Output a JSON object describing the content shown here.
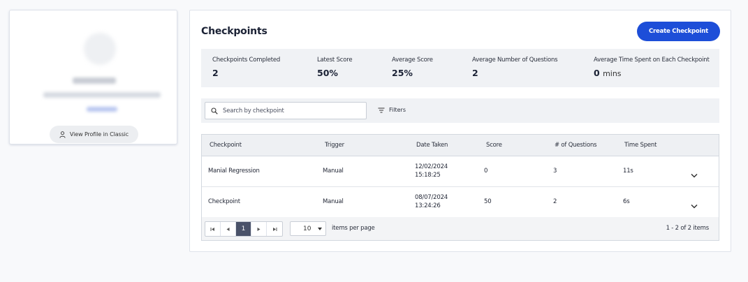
{
  "profile": {
    "view_profile_label": "View Profile in Classic"
  },
  "panel": {
    "title": "Checkpoints",
    "create_label": "Create Checkpoint"
  },
  "stats": [
    {
      "label": "Checkpoints Completed",
      "value": "2"
    },
    {
      "label": "Latest Score",
      "value": "50%"
    },
    {
      "label": "Average Score",
      "value": "25%"
    },
    {
      "label": "Average Number of Questions",
      "value": "2"
    },
    {
      "label": "Average Time Spent on Each Checkpoint",
      "value": "0",
      "unit": "mins"
    }
  ],
  "search": {
    "placeholder": "Search by checkpoint",
    "value": ""
  },
  "filters_label": "Filters",
  "table": {
    "columns": [
      "Checkpoint",
      "Trigger",
      "Date Taken",
      "Score",
      "# of Questions",
      "Time Spent"
    ],
    "rows": [
      {
        "checkpoint": "Manial Regression",
        "trigger": "Manual",
        "date": "12/02/2024",
        "time": "15:18:25",
        "score": "0",
        "questions": "3",
        "time_spent": "11s"
      },
      {
        "checkpoint": "Checkpoint",
        "trigger": "Manual",
        "date": "08/07/2024",
        "time": "13:24:26",
        "score": "50",
        "questions": "2",
        "time_spent": "6s"
      }
    ]
  },
  "pager": {
    "current_page": "1",
    "page_size": "10",
    "per_page_label": "items per page",
    "info": "1 - 2 of 2 items"
  },
  "colors": {
    "primary": "#1d4ed8",
    "active_page": "#4a5269"
  }
}
